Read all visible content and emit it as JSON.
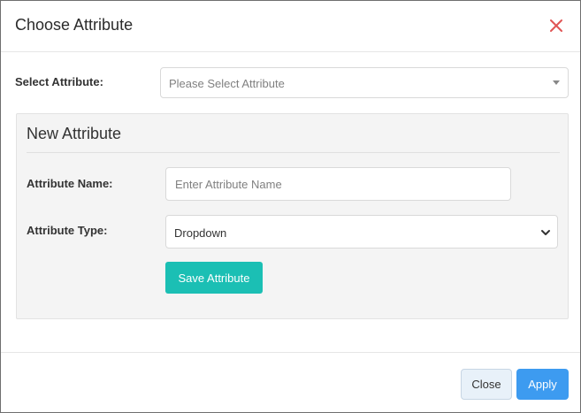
{
  "modal": {
    "title": "Choose Attribute",
    "close_icon": "close-x-icon",
    "accent_color": "#e05555"
  },
  "select_attribute": {
    "label": "Select Attribute:",
    "placeholder": "Please Select Attribute",
    "icon": "caret-down-icon"
  },
  "new_attribute": {
    "title": "New Attribute",
    "name_label": "Attribute Name:",
    "name_placeholder": "Enter Attribute Name",
    "name_value": "",
    "type_label": "Attribute Type:",
    "type_value": "Dropdown",
    "type_icon": "chevron-down-icon",
    "save_label": "Save Attribute",
    "save_color": "#1bbfb4"
  },
  "footer": {
    "close_label": "Close",
    "apply_label": "Apply",
    "apply_color": "#3d9bf0"
  }
}
